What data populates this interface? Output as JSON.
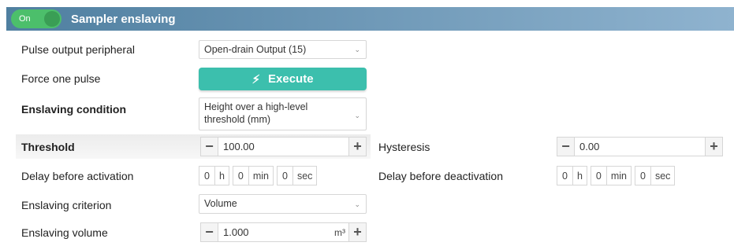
{
  "header": {
    "toggle_label": "On",
    "title": "Sampler enslaving"
  },
  "rows": {
    "pulse_output": {
      "label": "Pulse output peripheral",
      "value": "Open-drain Output (15)"
    },
    "force_pulse": {
      "label": "Force one pulse",
      "button": "Execute"
    },
    "enslaving_condition": {
      "label": "Enslaving condition",
      "value_line1": "Height over a high-level",
      "value_line2": "threshold (mm)"
    },
    "threshold": {
      "label": "Threshold",
      "value": "100.00"
    },
    "hysteresis": {
      "label": "Hysteresis",
      "value": "0.00"
    },
    "delay_activation": {
      "label": "Delay before activation",
      "h": "0",
      "h_unit": "h",
      "min": "0",
      "min_unit": "min",
      "sec": "0",
      "sec_unit": "sec"
    },
    "delay_deactivation": {
      "label": "Delay before deactivation",
      "h": "0",
      "h_unit": "h",
      "min": "0",
      "min_unit": "min",
      "sec": "0",
      "sec_unit": "sec"
    },
    "enslaving_criterion": {
      "label": "Enslaving criterion",
      "value": "Volume"
    },
    "enslaving_volume": {
      "label": "Enslaving volume",
      "value": "1.000",
      "unit": "m³"
    }
  },
  "colors": {
    "header_gradient_start": "#4f7fa0",
    "header_gradient_end": "#8fb3cf",
    "toggle_on": "#4cbf6b",
    "execute_button": "#3cbfad"
  },
  "icons": {
    "select_caret": "chevron-down-icon",
    "execute": "lightning-bolt-icon",
    "minus": "minus-icon",
    "plus": "plus-icon"
  }
}
